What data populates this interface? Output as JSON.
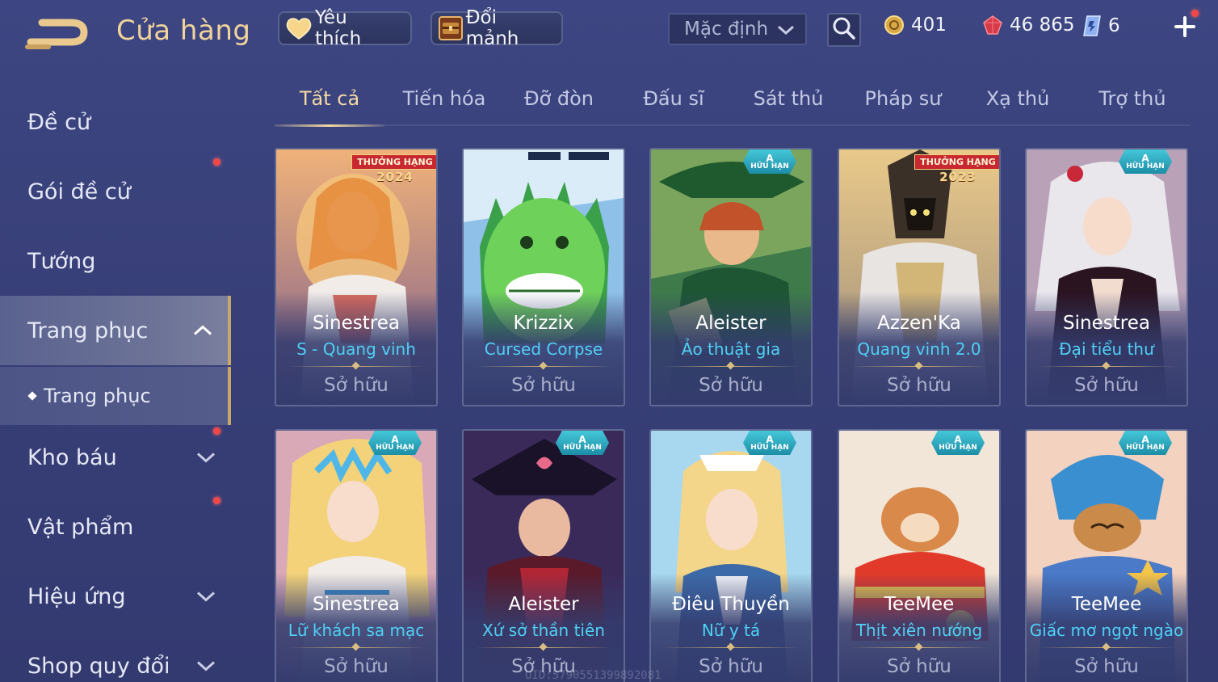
{
  "header": {
    "title": "Cửa hàng",
    "favorite_label": "Yêu thích",
    "shard_label": "Đổi mảnh",
    "sort_value": "Mặc định",
    "currencies": {
      "gold": "401",
      "gems": "46 865",
      "tickets": "6"
    }
  },
  "sidebar": {
    "items": [
      {
        "label": "Đề cử"
      },
      {
        "label": "Gói đề cử"
      },
      {
        "label": "Tướng"
      },
      {
        "label": "Trang phục"
      },
      {
        "label": "Trang phục"
      },
      {
        "label": "Kho báu"
      },
      {
        "label": "Vật phẩm"
      },
      {
        "label": "Hiệu ứng"
      },
      {
        "label": "Shop quy đổi"
      }
    ]
  },
  "tabs": [
    {
      "label": "Tất cả"
    },
    {
      "label": "Tiến hóa"
    },
    {
      "label": "Đỡ đòn"
    },
    {
      "label": "Đấu sĩ"
    },
    {
      "label": "Sát thủ"
    },
    {
      "label": "Pháp sư"
    },
    {
      "label": "Xạ thủ"
    },
    {
      "label": "Trợ thủ"
    }
  ],
  "badges": {
    "ranked": "THƯỞNG HẠNG",
    "limited_grade": "A",
    "limited": "HỮU HẠN"
  },
  "cards": [
    {
      "hero": "Sinestrea",
      "skin": "S - Quang vinh",
      "status": "Sở hữu",
      "badge_year": "2024"
    },
    {
      "hero": "Krizzix",
      "skin": "Cursed Corpse",
      "status": "Sở hữu"
    },
    {
      "hero": "Aleister",
      "skin": "Ảo thuật gia",
      "status": "Sở hữu"
    },
    {
      "hero": "Azzen'Ka",
      "skin": "Quang vinh 2.0",
      "status": "Sở hữu",
      "badge_year": "2023"
    },
    {
      "hero": "Sinestrea",
      "skin": "Đại tiểu thư",
      "status": "Sở hữu"
    },
    {
      "hero": "Sinestrea",
      "skin": "Lữ khách sa mạc",
      "status": "Sở hữu"
    },
    {
      "hero": "Aleister",
      "skin": "Xứ sở thần tiên",
      "status": "Sở hữu"
    },
    {
      "hero": "Điêu Thuyền",
      "skin": "Nữ y tá",
      "status": "Sở hữu"
    },
    {
      "hero": "TeeMee",
      "skin": "Thịt xiên nướng",
      "status": "Sở hữu"
    },
    {
      "hero": "TeeMee",
      "skin": "Giấc mơ ngọt ngào",
      "status": "Sở hữu"
    }
  ],
  "footer": {
    "uid": "UID:5790551399892081"
  },
  "colors": {
    "accent_gold": "#f1d39c",
    "skin_name": "#4fd0f5",
    "background": "#3a4279"
  }
}
